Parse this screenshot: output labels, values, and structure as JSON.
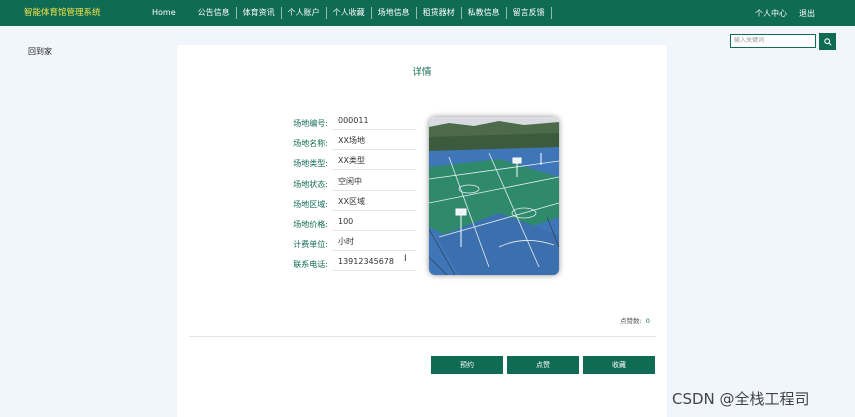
{
  "header": {
    "brand": "智能体育馆管理系统",
    "nav": [
      "Home",
      "公告信息",
      "体育资讯",
      "个人账户",
      "个人收藏",
      "场地信息",
      "租赁器材",
      "私教信息",
      "留言反馈"
    ],
    "user_center": "个人中心",
    "logout": "退出"
  },
  "search": {
    "placeholder": "输入关键词"
  },
  "back_label": "回到家",
  "detail": {
    "title": "详情",
    "fields": [
      {
        "label": "场地编号:",
        "value": "000011"
      },
      {
        "label": "场地名称:",
        "value": "XX场地"
      },
      {
        "label": "场地类型:",
        "value": "XX类型"
      },
      {
        "label": "场地状态:",
        "value": "空闲中"
      },
      {
        "label": "场地区域:",
        "value": "XX区域"
      },
      {
        "label": "场地价格:",
        "value": "100"
      },
      {
        "label": "计费单位:",
        "value": "小时"
      },
      {
        "label": "联系电话:",
        "value": "13912345678"
      }
    ],
    "likes_label": "点赞数:",
    "likes_count": "0",
    "buttons": {
      "book": "预约",
      "like": "点赞",
      "favorite": "收藏"
    }
  },
  "watermark": "CSDN @全栈工程司",
  "colors": {
    "primary": "#0f6b53",
    "brand_text": "#f6e44a",
    "page_bg": "#f0f6fb"
  },
  "icons": {
    "search": "search-icon",
    "cursor": "text-cursor-icon"
  }
}
